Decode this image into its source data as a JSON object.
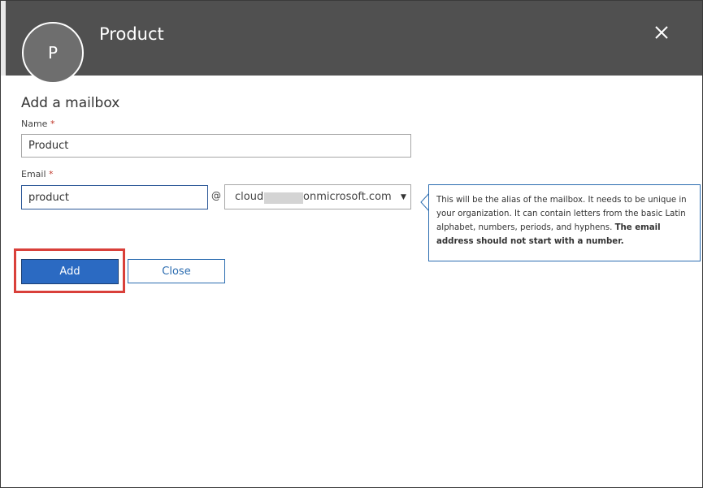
{
  "header": {
    "avatar_initial": "P",
    "title": "Product",
    "close_icon": "close-icon"
  },
  "form": {
    "section_title": "Add a mailbox",
    "name": {
      "label": "Name",
      "required_marker": "*",
      "value": "Product"
    },
    "email": {
      "label": "Email",
      "required_marker": "*",
      "value": "product",
      "at_sign": "@",
      "domain_prefix": "cloud",
      "domain_suffix": "onmicrosoft.com",
      "dropdown_icon": "chevron-down-icon"
    }
  },
  "tooltip": {
    "text": "This will be the alias of the mailbox. It needs to be unique in your organization. It can contain letters from the basic Latin alphabet, numbers, periods, and hyphens.",
    "bold_text": "The email address should not start with a number."
  },
  "actions": {
    "add_label": "Add",
    "close_label": "Close"
  },
  "colors": {
    "header_bg": "#505050",
    "primary_button": "#2b6ac2",
    "accent_border": "#2b6cb0",
    "highlight": "#d9403a",
    "required": "#c0392b"
  }
}
